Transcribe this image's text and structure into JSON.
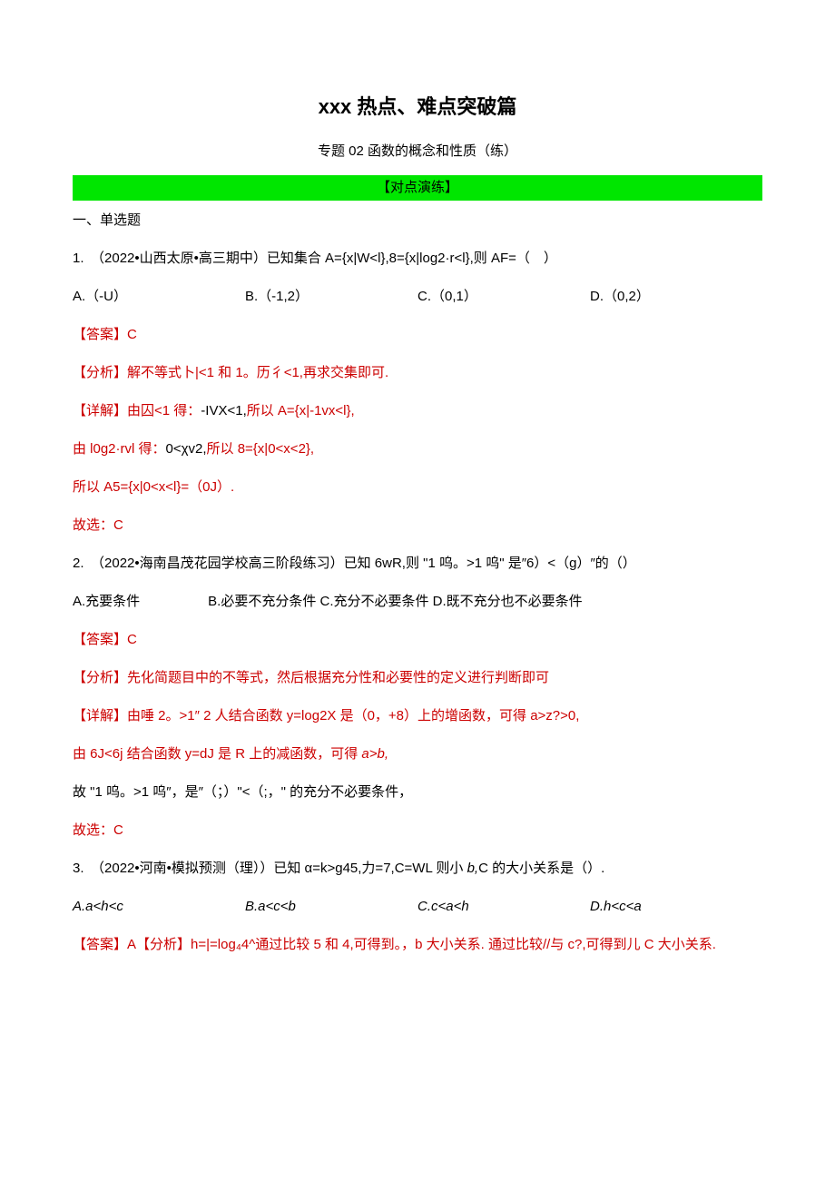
{
  "title": "xxx 热点、难点突破篇",
  "subtitle": "专题 02 函数的概念和性质（练）",
  "banner": "【对点演练】",
  "sectionHeading": "一、单选题",
  "q1": {
    "stem": "1.　（2022•山西太原•高三期中）已知集合 A={x|W<l},8={x|log2·r<l},则 AF=（　）",
    "opts": {
      "A": "A.（-U）",
      "B": "B.（-1,2）",
      "C": "C.（0,1）",
      "D": "D.（0,2）"
    },
    "ans": "【答案】C",
    "fx_prefix": "【分析】",
    "fx_body": "解不等式卜|<1 和 1。历彳<1,再求交集即可.",
    "xj_prefix": "【详解】",
    "xj_l1a": "由囚<1 得：",
    "xj_l1b": "-IVX<1,",
    "xj_l1c": "所以 A={x|-1vx<l},",
    "xj_l2a": "由 l0g2·rvl 得：",
    "xj_l2b": "0<χv2,",
    "xj_l2c": "所以 8={x|0<x<2},",
    "xj_l3a": "所以 A5={x|0<x<l}=（0J）.",
    "select": "故选：C"
  },
  "q2": {
    "stem": "2.　（2022•海南昌茂花园学校高三阶段练习）已知 6wR,则 \"1 呜。>1 呜\" 是″6）<（g）″的（）",
    "opts": "A.充要条件　　　　　B.必要不充分条件 C.充分不必要条件 D.既不充分也不必要条件",
    "ans": "【答案】C",
    "fx_prefix": "【分析】",
    "fx_body": "先化简题目中的不等式，然后根据充分性和必要性的定义进行判断即可",
    "xj_prefix": "【详解】",
    "xj_l1a": "由唾 2。>1″ 2 人结",
    "xj_l1b": "合函数 y=log2X 是（0，+8）上的增函数，可得 a>z?>0,",
    "xj_l2a": "由 6J<6j 结合函数 y=dJ 是 R 上的减函数，可得 ",
    "xj_l2b": "a>b,",
    "xj_l3": "故 \"1 呜。>1 呜″，是″（；）\"<（;，\" 的充分不必要条件，",
    "select": "故选：C"
  },
  "q3": {
    "stem_a": "3.　（2022•河南•模拟预测（理））已知 α=k>g45,力=7,C=WL 则小 ",
    "stem_b": "b,",
    "stem_c": "C 的大小关系是（）.",
    "opts": {
      "A": "A.a<h<c",
      "B": "B.a<c<b",
      "C": "C.c<a<h",
      "D": "D.h<c<a"
    },
    "ans_prefix": "【答案】A",
    "fx_prefix": "【分析】",
    "fx_body_a": "h=|=log₄4^通过比较 5 和 4,可得到。，b 大小关系. 通过比较//与 c?,可得到儿 C 大小关系."
  }
}
